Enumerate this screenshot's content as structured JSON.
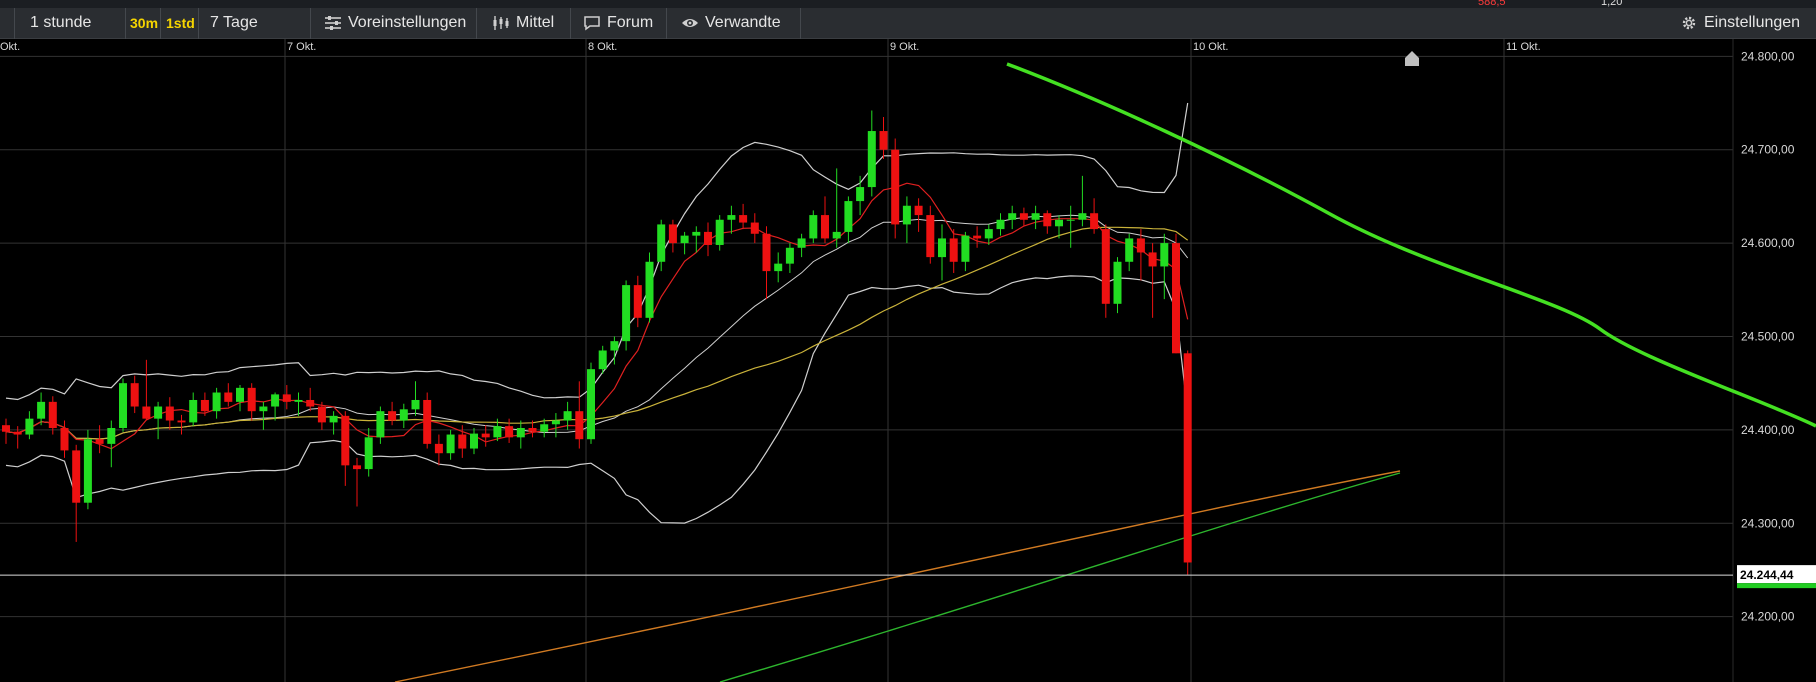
{
  "toolbar": {
    "timeframe": "1 stunde",
    "preset_30m": "30m",
    "preset_1std": "1std",
    "range": "7 Tage",
    "settings_presets": "Voreinstellungen",
    "indicator": "Mittel",
    "forum": "Forum",
    "related": "Verwandte",
    "settings": "Einstellungen",
    "top_value_red": "588,5",
    "top_value": "1,20"
  },
  "colors": {
    "background": "#000000",
    "bullish": "#22dd22",
    "bearish": "#ee1111",
    "bollinger": "#cfcfcf",
    "sma_short": "#e02020",
    "sma_mid": "#c9b23a",
    "sma_long_orange": "#d07a22",
    "sma_long_green": "#2db52d",
    "trendline": "#44e022",
    "grid": "#333333"
  },
  "chart_data": {
    "type": "candlestick",
    "x_labels": [
      "7 Okt.",
      "8 Okt.",
      "9 Okt.",
      "10 Okt.",
      "11 Okt."
    ],
    "y_ticks": [
      "24.200,00",
      "24.300,00",
      "24.400,00",
      "24.500,00",
      "24.600,00",
      "24.700,00",
      "24.800,00"
    ],
    "ylim": [
      24130,
      24810
    ],
    "last_price_label": "24.244,44",
    "last_price": 24244.44,
    "candles": [
      [
        24405,
        24412,
        24385,
        24398
      ],
      [
        24398,
        24404,
        24380,
        24395
      ],
      [
        24395,
        24420,
        24390,
        24412
      ],
      [
        24412,
        24440,
        24405,
        24430
      ],
      [
        24430,
        24436,
        24395,
        24402
      ],
      [
        24402,
        24410,
        24370,
        24378
      ],
      [
        24378,
        24384,
        24280,
        24322
      ],
      [
        24322,
        24400,
        24315,
        24390
      ],
      [
        24390,
        24405,
        24375,
        24385
      ],
      [
        24385,
        24410,
        24360,
        24402
      ],
      [
        24402,
        24455,
        24398,
        24450
      ],
      [
        24450,
        24458,
        24418,
        24425
      ],
      [
        24425,
        24475,
        24410,
        24412
      ],
      [
        24412,
        24430,
        24390,
        24425
      ],
      [
        24425,
        24435,
        24400,
        24410
      ],
      [
        24410,
        24416,
        24395,
        24408
      ],
      [
        24408,
        24440,
        24404,
        24432
      ],
      [
        24432,
        24440,
        24415,
        24420
      ],
      [
        24420,
        24445,
        24412,
        24440
      ],
      [
        24440,
        24450,
        24425,
        24430
      ],
      [
        24430,
        24448,
        24420,
        24445
      ],
      [
        24445,
        24450,
        24410,
        24420
      ],
      [
        24420,
        24430,
        24400,
        24425
      ],
      [
        24425,
        24440,
        24410,
        24438
      ],
      [
        24438,
        24448,
        24422,
        24430
      ],
      [
        24430,
        24440,
        24415,
        24432
      ],
      [
        24432,
        24445,
        24420,
        24425
      ],
      [
        24425,
        24430,
        24400,
        24408
      ],
      [
        24408,
        24420,
        24395,
        24415
      ],
      [
        24415,
        24420,
        24340,
        24362
      ],
      [
        24362,
        24370,
        24318,
        24358
      ],
      [
        24358,
        24402,
        24350,
        24392
      ],
      [
        24392,
        24425,
        24385,
        24420
      ],
      [
        24420,
        24430,
        24405,
        24410
      ],
      [
        24410,
        24428,
        24402,
        24422
      ],
      [
        24422,
        24452,
        24415,
        24432
      ],
      [
        24432,
        24440,
        24380,
        24385
      ],
      [
        24385,
        24395,
        24362,
        24375
      ],
      [
        24375,
        24400,
        24368,
        24395
      ],
      [
        24395,
        24405,
        24370,
        24380
      ],
      [
        24380,
        24402,
        24374,
        24396
      ],
      [
        24396,
        24405,
        24382,
        24392
      ],
      [
        24392,
        24412,
        24388,
        24404
      ],
      [
        24404,
        24412,
        24386,
        24392
      ],
      [
        24392,
        24410,
        24380,
        24402
      ],
      [
        24402,
        24410,
        24392,
        24398
      ],
      [
        24398,
        24412,
        24392,
        24406
      ],
      [
        24406,
        24418,
        24392,
        24410
      ],
      [
        24410,
        24430,
        24400,
        24420
      ],
      [
        24420,
        24452,
        24380,
        24390
      ],
      [
        24390,
        24472,
        24385,
        24465
      ],
      [
        24465,
        24490,
        24460,
        24485
      ],
      [
        24485,
        24500,
        24470,
        24495
      ],
      [
        24495,
        24560,
        24485,
        24555
      ],
      [
        24555,
        24565,
        24510,
        24520
      ],
      [
        24520,
        24590,
        24515,
        24580
      ],
      [
        24580,
        24625,
        24570,
        24620
      ],
      [
        24620,
        24625,
        24590,
        24600
      ],
      [
        24600,
        24612,
        24588,
        24608
      ],
      [
        24608,
        24618,
        24590,
        24612
      ],
      [
        24612,
        24622,
        24586,
        24598
      ],
      [
        24598,
        24630,
        24592,
        24625
      ],
      [
        24625,
        24640,
        24610,
        24630
      ],
      [
        24630,
        24642,
        24615,
        24622
      ],
      [
        24622,
        24632,
        24600,
        24610
      ],
      [
        24610,
        24618,
        24540,
        24570
      ],
      [
        24570,
        24590,
        24558,
        24578
      ],
      [
        24578,
        24600,
        24568,
        24595
      ],
      [
        24595,
        24610,
        24585,
        24605
      ],
      [
        24605,
        24635,
        24600,
        24630
      ],
      [
        24630,
        24650,
        24600,
        24605
      ],
      [
        24605,
        24680,
        24595,
        24612
      ],
      [
        24612,
        24650,
        24600,
        24645
      ],
      [
        24645,
        24672,
        24630,
        24660
      ],
      [
        24660,
        24742,
        24650,
        24720
      ],
      [
        24720,
        24735,
        24690,
        24700
      ],
      [
        24700,
        24712,
        24605,
        24620
      ],
      [
        24620,
        24650,
        24600,
        24640
      ],
      [
        24640,
        24648,
        24612,
        24630
      ],
      [
        24630,
        24640,
        24578,
        24585
      ],
      [
        24585,
        24620,
        24560,
        24605
      ],
      [
        24605,
        24615,
        24568,
        24580
      ],
      [
        24580,
        24612,
        24570,
        24608
      ],
      [
        24608,
        24618,
        24595,
        24605
      ],
      [
        24605,
        24620,
        24598,
        24615
      ],
      [
        24615,
        24632,
        24608,
        24625
      ],
      [
        24625,
        24640,
        24615,
        24632
      ],
      [
        24632,
        24638,
        24618,
        24625
      ],
      [
        24625,
        24640,
        24615,
        24632
      ],
      [
        24632,
        24635,
        24610,
        24618
      ],
      [
        24618,
        24630,
        24605,
        24625
      ],
      [
        24625,
        24640,
        24595,
        24625
      ],
      [
        24625,
        24672,
        24618,
        24632
      ],
      [
        24632,
        24648,
        24610,
        24615
      ],
      [
        24615,
        24620,
        24520,
        24535
      ],
      [
        24535,
        24585,
        24525,
        24580
      ],
      [
        24580,
        24610,
        24570,
        24605
      ],
      [
        24605,
        24615,
        24560,
        24590
      ],
      [
        24590,
        24600,
        24520,
        24575
      ],
      [
        24575,
        24610,
        24540,
        24600
      ],
      [
        24600,
        24610,
        24482,
        24482
      ],
      [
        24482,
        24485,
        24245,
        24258
      ]
    ]
  }
}
